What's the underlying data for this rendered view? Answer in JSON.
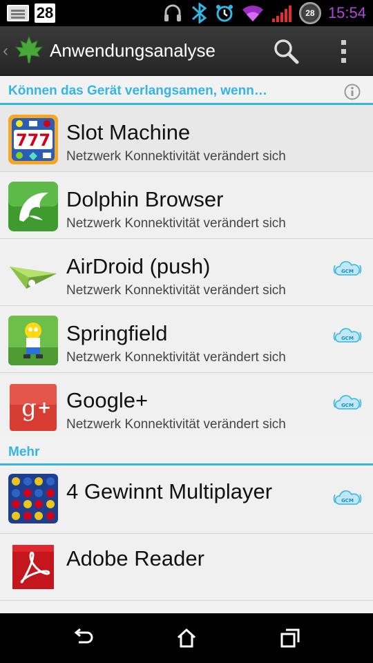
{
  "status_bar": {
    "calendar_day": "28",
    "badge_number": "28",
    "time": "15:54",
    "time_color": "#b04ad6"
  },
  "action_bar": {
    "title": "Anwendungsanalyse",
    "icons": [
      "back-chevron-icon",
      "maple-leaf-icon",
      "search-icon",
      "overflow-menu-icon"
    ]
  },
  "sections": [
    {
      "title": "Können das Gerät verlangsamen, wenn…",
      "items": [
        {
          "name": "Slot Machine",
          "subtitle": "Netzwerk Konnektivität verändert sich",
          "icon": "slot-machine-icon",
          "gcm": false
        },
        {
          "name": "Dolphin Browser",
          "subtitle": "Netzwerk Konnektivität verändert sich",
          "icon": "dolphin-icon",
          "gcm": false
        },
        {
          "name": "AirDroid (push)",
          "subtitle": "Netzwerk Konnektivität verändert sich",
          "icon": "paper-plane-icon",
          "gcm": true
        },
        {
          "name": "Springfield",
          "subtitle": "Netzwerk Konnektivität verändert sich",
          "icon": "springfield-icon",
          "gcm": true
        },
        {
          "name": "Google+",
          "subtitle": "Netzwerk Konnektivität verändert sich",
          "icon": "google-plus-icon",
          "gcm": true
        }
      ]
    },
    {
      "title": "Mehr",
      "items": [
        {
          "name": "4 Gewinnt Multiplayer",
          "subtitle": "",
          "icon": "connect-four-icon",
          "gcm": true
        },
        {
          "name": "Adobe Reader",
          "subtitle": "",
          "icon": "adobe-reader-icon",
          "gcm": false
        }
      ]
    }
  ],
  "gcm_label": "GCM",
  "colors": {
    "accent": "#33b5e5",
    "action_bar": "#2e2e2e",
    "google_plus": "#d73d32",
    "adobe": "#c4161c"
  }
}
